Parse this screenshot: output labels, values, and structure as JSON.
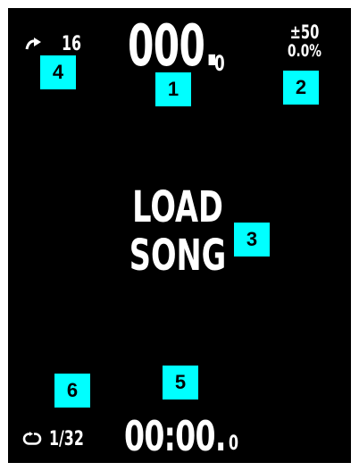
{
  "display": {
    "key_shift": {
      "icon": "redo-arrow-icon",
      "value": "16"
    },
    "bpm": {
      "main": "000.",
      "fraction": "0"
    },
    "pitch": {
      "range": "±50",
      "percent": "0.0%"
    },
    "center_message": {
      "line1": "LOAD",
      "line2": "SONG"
    },
    "loop": {
      "icon": "loop-icon",
      "value": "1/32"
    },
    "time": {
      "main": "00:00.",
      "fraction": "0"
    }
  },
  "callouts": [
    "1",
    "2",
    "3",
    "4",
    "5",
    "6"
  ],
  "colors": {
    "background": "#000000",
    "text": "#ffffff",
    "callout": "#00ffff"
  }
}
